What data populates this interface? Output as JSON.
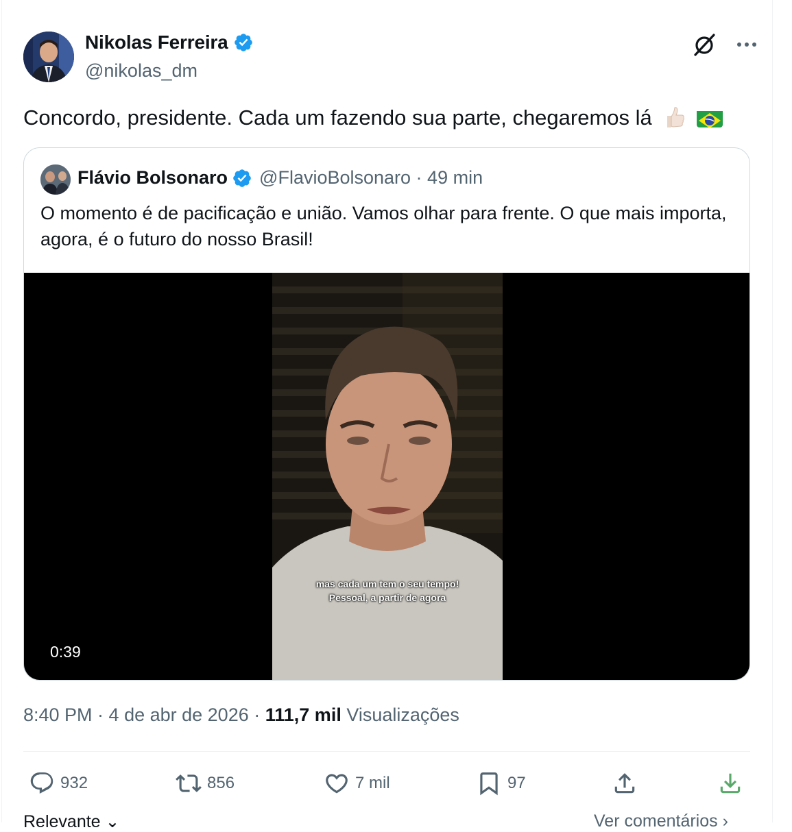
{
  "author": {
    "name": "Nikolas Ferreira",
    "handle": "@nikolas_dm"
  },
  "header_icons": [
    "grok-icon",
    "more-icon"
  ],
  "tweet": {
    "text": "Concordo, presidente. Cada um fazendo sua parte, chegaremos lá"
  },
  "quoted": {
    "name": "Flávio Bolsonaro",
    "meta": "@FlavioBolsonaro · 49 min",
    "text": "O momento é de pacificação e união. Vamos olhar para frente. O que mais importa, agora, é o futuro do nosso Brasil!",
    "video": {
      "subtitle_line_1": "mas cada um tem o seu tempo!",
      "subtitle_line_2": "Pessoal, a partir de agora",
      "duration": "0:39"
    }
  },
  "meta": {
    "time_date": "8:40 PM · 4 de abr de 2026 · ",
    "views_count": "111,7 mil",
    "views_label": " Visualizações"
  },
  "actions": {
    "replies": "932",
    "retweets": "856",
    "likes": "7 mil",
    "bookmarks": "97"
  },
  "footer": {
    "left": "Relevante ⌄",
    "right": "Ver comentários ›"
  },
  "colors": {
    "verified": "#1d9bf0",
    "secondary_text": "#536471",
    "download_green": "#5aa96b"
  }
}
